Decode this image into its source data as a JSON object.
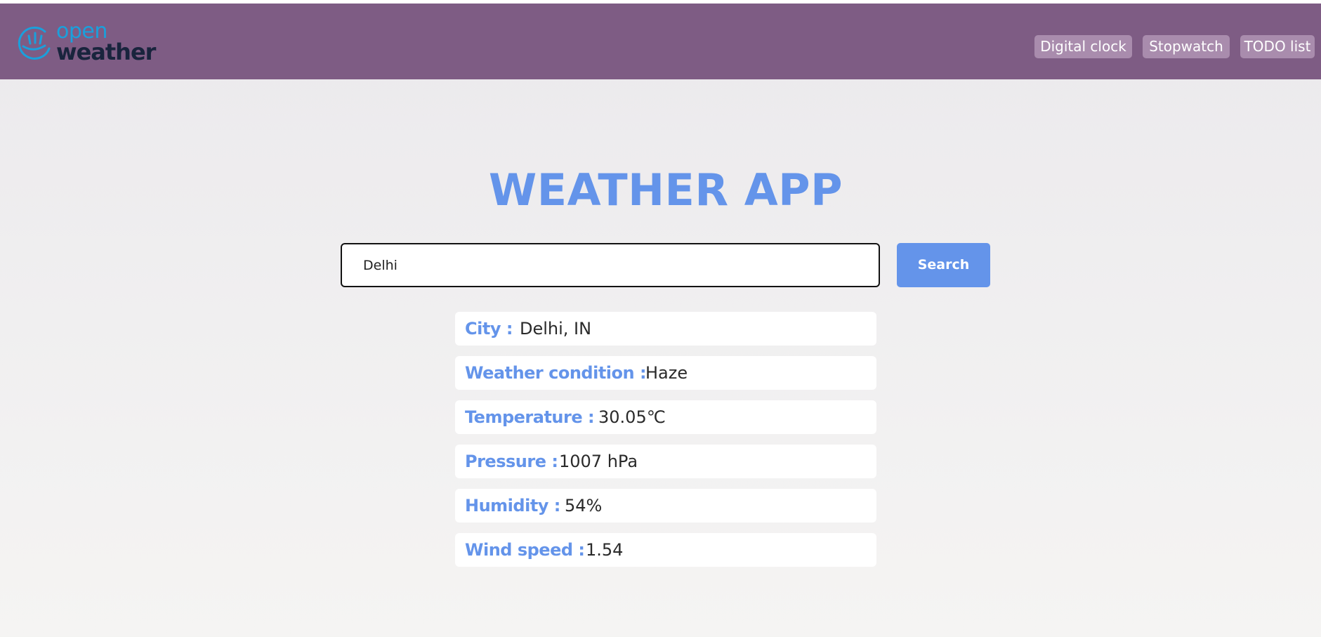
{
  "header": {
    "logo": {
      "line1": "open",
      "line2": "weather",
      "icon": "openweather-sun-logo-icon"
    },
    "nav": [
      {
        "label": "Digital clock"
      },
      {
        "label": "Stopwatch"
      },
      {
        "label": "TODO list"
      }
    ]
  },
  "main": {
    "title": "WEATHER APP",
    "search": {
      "value": "Delhi",
      "button_label": "Search"
    },
    "details": [
      {
        "label": "City :",
        "value": "Delhi, IN"
      },
      {
        "label": "Weather condition :",
        "value": "Haze"
      },
      {
        "label": "Temperature :",
        "value": "30.05℃"
      },
      {
        "label": "Pressure :",
        "value": "1007 hPa"
      },
      {
        "label": "Humidity :",
        "value": "54%"
      },
      {
        "label": "Wind speed :",
        "value": "1.54"
      }
    ]
  },
  "colors": {
    "header_bg": "#7e5c84",
    "nav_bg": "#a98cad",
    "accent": "#6494ea",
    "logo_open": "#1aa0dc",
    "logo_weather": "#19243d"
  }
}
